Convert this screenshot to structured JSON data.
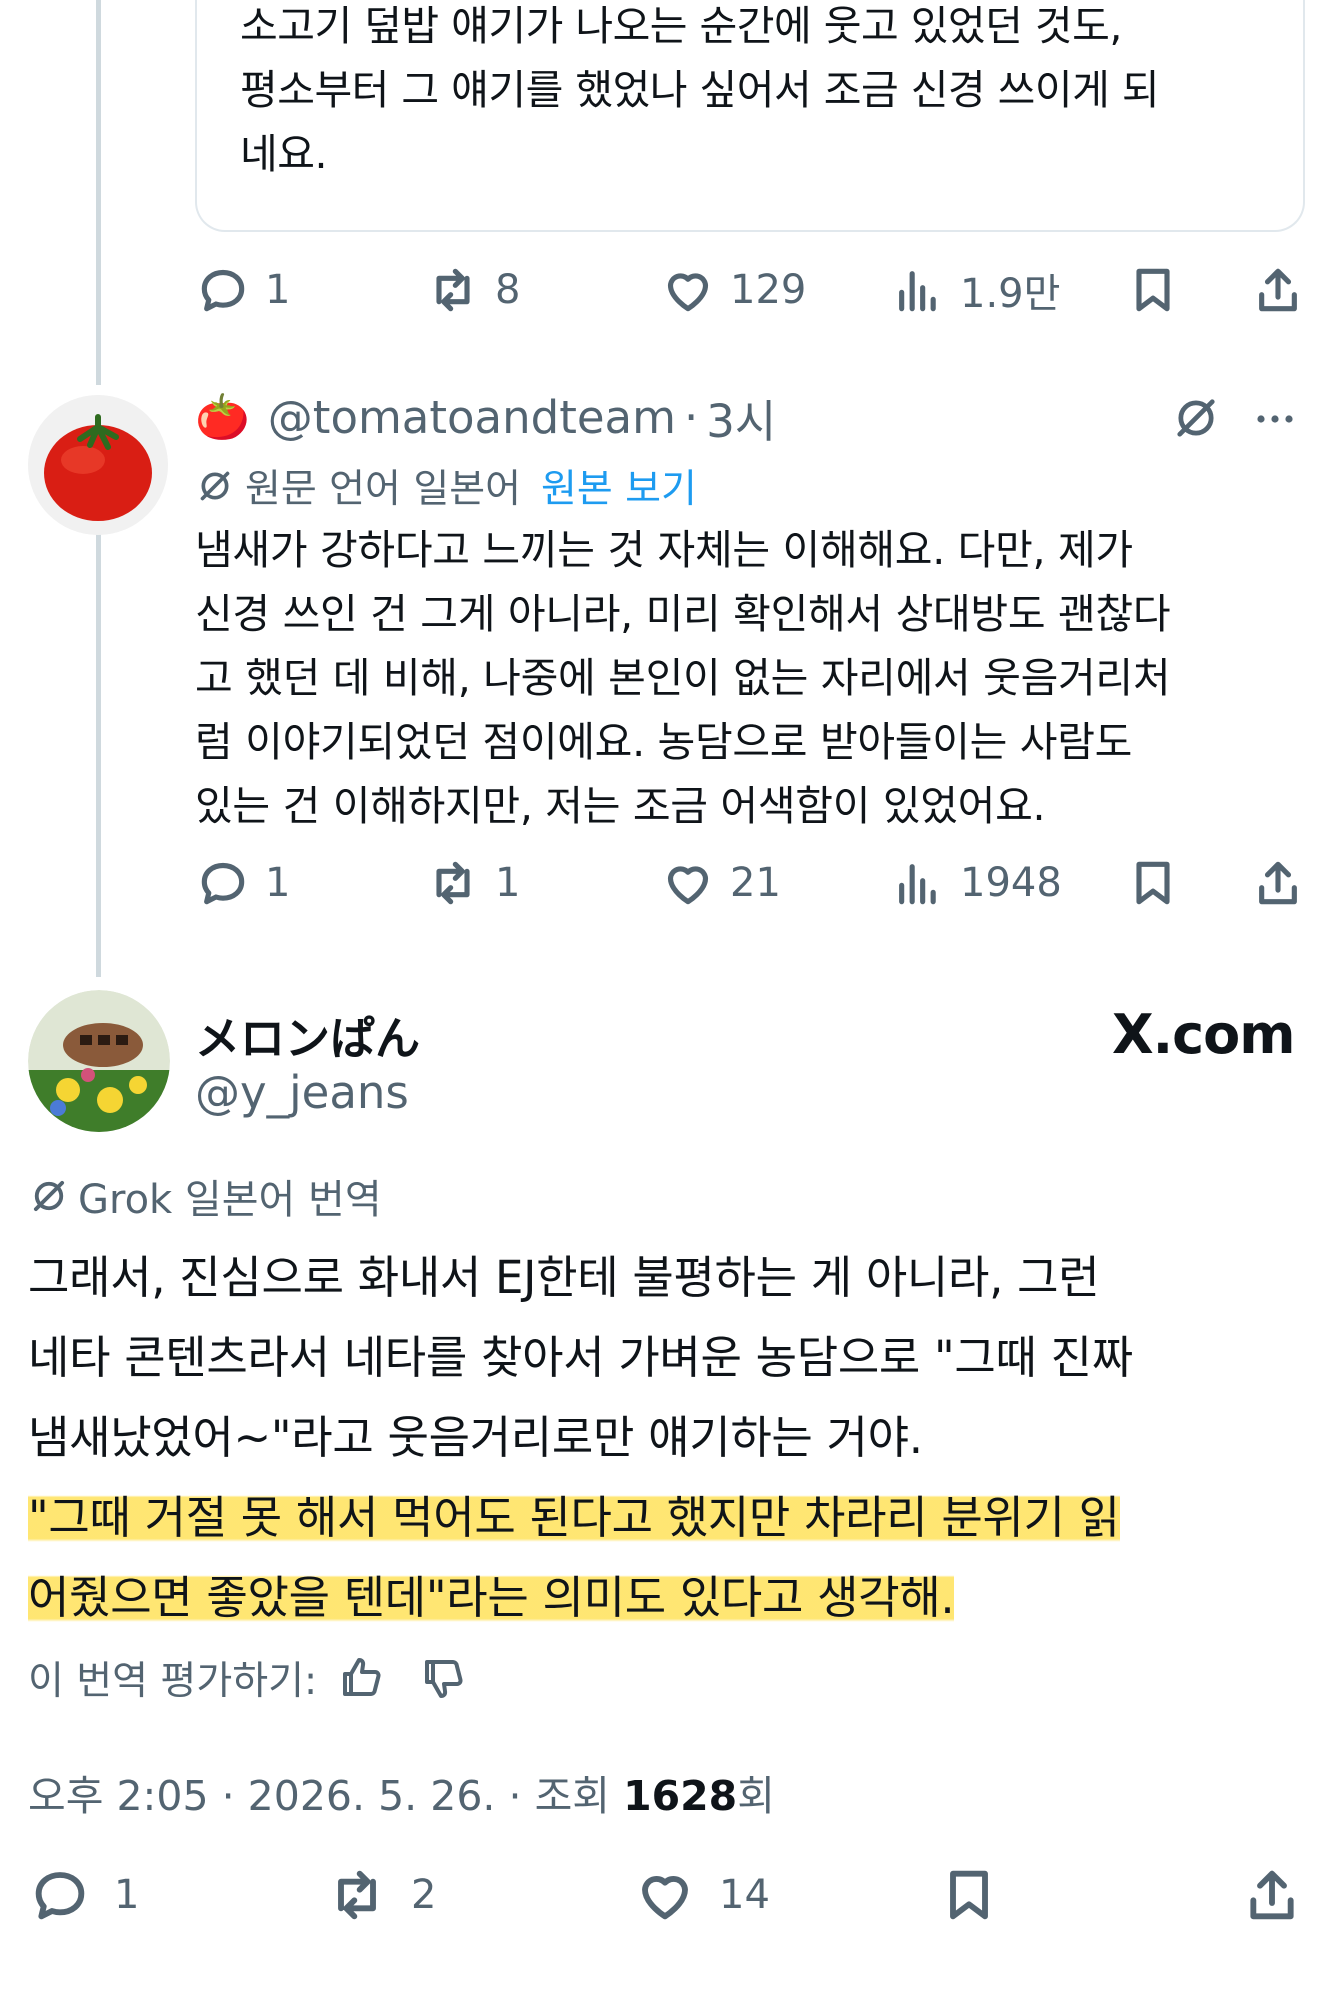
{
  "quoted_post": {
    "text_lines": [
      "소고기 덮밥 얘기가 나오는 순간에 웃고 있었던 것도,",
      "평소부터 그 얘기를 했었나 싶어서 조금 신경 쓰이게 되",
      "네요."
    ],
    "actions": {
      "replies": "1",
      "reposts": "8",
      "likes": "129",
      "views": "1.9만"
    }
  },
  "reply_post": {
    "emoji": "🍅",
    "handle": "@tomatoandteam",
    "separator": "·",
    "time": "3시",
    "translation_label": "원문 언어 일본어",
    "view_original": "원본 보기",
    "text_lines": [
      "냄새가 강하다고 느끼는 것 자체는 이해해요. 다만, 제가",
      "신경 쓰인 건 그게 아니라, 미리 확인해서 상대방도 괜찮다",
      "고 했던 데 비해, 나중에 본인이 없는 자리에서 웃음거리처",
      "럼 이야기되었던 점이에요. 농담으로 받아들이는 사람도",
      "있는 건 이해하지만, 저는 조금 어색함이 있었어요."
    ],
    "actions": {
      "replies": "1",
      "reposts": "1",
      "likes": "21",
      "views": "1948"
    }
  },
  "main_post": {
    "display_name": "メロンぱん",
    "handle": "@y_jeans",
    "brand": "X.com",
    "translation_label": "Grok 일본어 번역",
    "text_lines": [
      "그래서, 진심으로 화내서 EJ한테 불평하는 게 아니라, 그런",
      "네타 콘텐츠라서 네타를 찾아서 가벼운 농담으로 \"그때 진짜",
      "냄새났었어~\"라고 웃음거리로만 얘기하는 거야."
    ],
    "highlighted_lines": [
      "\"그때 거절 못 해서 먹어도 된다고 했지만 차라리 분위기 읽",
      "어줬으면 좋았을 텐데\"라는 의미도 있다고 생각해."
    ],
    "rate_translation": "이 번역 평가하기:",
    "meta": {
      "time": "오후 2:05",
      "date": "2026. 5. 26.",
      "views_label": "조회",
      "views_count": "1628",
      "views_suffix": "회"
    },
    "actions": {
      "replies": "1",
      "reposts": "2",
      "likes": "14"
    }
  }
}
